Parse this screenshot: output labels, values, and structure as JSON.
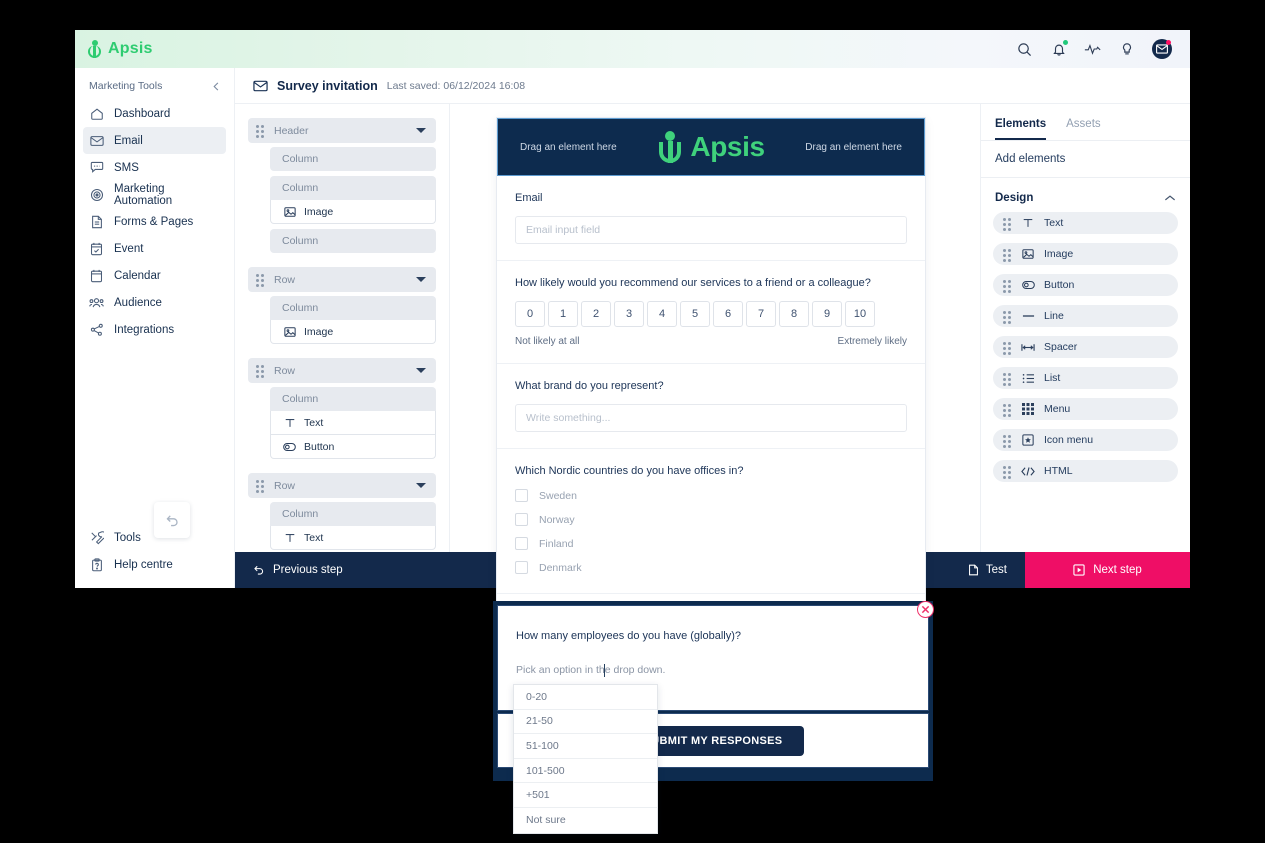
{
  "app": {
    "brand": "Apsis",
    "top_icons": [
      "search-icon",
      "bell-icon",
      "activity-icon",
      "lightbulb-icon",
      "inbox-avatar-icon"
    ]
  },
  "sidebar": {
    "section_label": "Marketing Tools",
    "collapse_icon": "chevron-left-icon",
    "items": [
      {
        "label": "Dashboard",
        "icon": "home-icon",
        "active": false
      },
      {
        "label": "Email",
        "icon": "envelope-icon",
        "active": true
      },
      {
        "label": "SMS",
        "icon": "chat-icon",
        "active": false
      },
      {
        "label": "Marketing Automation",
        "icon": "target-icon",
        "active": false
      },
      {
        "label": "Forms & Pages",
        "icon": "document-icon",
        "active": false
      },
      {
        "label": "Event",
        "icon": "calendar-check-icon",
        "active": false
      },
      {
        "label": "Calendar",
        "icon": "calendar-icon",
        "active": false
      },
      {
        "label": "Audience",
        "icon": "people-icon",
        "active": false
      },
      {
        "label": "Integrations",
        "icon": "share-nodes-icon",
        "active": false
      }
    ],
    "bottom_items": [
      {
        "label": "Tools",
        "icon": "tools-icon"
      },
      {
        "label": "Help centre",
        "icon": "help-clipboard-icon"
      }
    ]
  },
  "header": {
    "icon": "envelope-icon",
    "title": "Survey invitation",
    "last_saved": "Last saved: 06/12/2024 16:08"
  },
  "tree": {
    "blocks": [
      {
        "label": "Header",
        "children": [
          {
            "type": "column",
            "label": "Column",
            "leaves": []
          },
          {
            "type": "column",
            "label": "Column",
            "leaves": [
              {
                "label": "Image",
                "icon": "image-icon"
              }
            ]
          },
          {
            "type": "column",
            "label": "Column",
            "leaves": []
          }
        ]
      },
      {
        "label": "Row",
        "children": [
          {
            "type": "column",
            "label": "Column",
            "leaves": [
              {
                "label": "Image",
                "icon": "image-icon"
              }
            ]
          }
        ]
      },
      {
        "label": "Row",
        "children": [
          {
            "type": "column",
            "label": "Column",
            "leaves": [
              {
                "label": "Text",
                "icon": "text-icon"
              },
              {
                "label": "Button",
                "icon": "button-icon"
              }
            ]
          }
        ]
      },
      {
        "label": "Row",
        "children": [
          {
            "type": "column",
            "label": "Column",
            "leaves": [
              {
                "label": "Text",
                "icon": "text-icon"
              }
            ]
          }
        ]
      }
    ]
  },
  "canvas": {
    "undo_icon": "undo-icon"
  },
  "elements_panel": {
    "tabs": [
      {
        "label": "Elements",
        "active": true
      },
      {
        "label": "Assets",
        "active": false
      }
    ],
    "add_elements_label": "Add elements",
    "design_section": {
      "title": "Design",
      "chevron": "chevron-up-icon",
      "items": [
        {
          "label": "Text",
          "icon": "text-icon"
        },
        {
          "label": "Image",
          "icon": "image-icon"
        },
        {
          "label": "Button",
          "icon": "button-icon"
        },
        {
          "label": "Line",
          "icon": "line-icon"
        },
        {
          "label": "Spacer",
          "icon": "spacer-icon"
        },
        {
          "label": "List",
          "icon": "list-icon"
        },
        {
          "label": "Menu",
          "icon": "menu-grid-icon"
        },
        {
          "label": "Icon menu",
          "icon": "icon-menu-icon"
        },
        {
          "label": "HTML",
          "icon": "code-icon"
        }
      ]
    }
  },
  "bottom_bar": {
    "previous_label": "Previous step",
    "previous_icon": "undo-icon",
    "test_label": "Test",
    "test_icon": "test-page-icon",
    "next_label": "Next step",
    "next_icon": "play-square-icon",
    "next_color": "#ef0e66"
  },
  "email_preview": {
    "header": {
      "drag_left": "Drag an element here",
      "drag_right": "Drag an element here",
      "logo_text": "Apsis",
      "bg_color": "#0d2b4e",
      "logo_color": "#3fd17c"
    },
    "email_field": {
      "label": "Email",
      "placeholder": "Email input field",
      "value": ""
    },
    "nps": {
      "question": "How likely would you recommend our services to a friend or a colleague?",
      "options": [
        "0",
        "1",
        "2",
        "3",
        "4",
        "5",
        "6",
        "7",
        "8",
        "9",
        "10"
      ],
      "low_label": "Not likely at all",
      "high_label": "Extremely likely"
    },
    "brand_field": {
      "question": "What brand do you represent?",
      "placeholder": "Write something...",
      "value": ""
    },
    "countries": {
      "question": "Which Nordic countries do you have offices in?",
      "options": [
        "Sweden",
        "Norway",
        "Finland",
        "Denmark"
      ]
    },
    "submit_label": "SUBMIT MY RESPONSES"
  },
  "dropdown_overlay": {
    "question": "How many employees do you have (globally)?",
    "hint": "Pick an option in the drop down.",
    "close_icon": "close-circle-icon",
    "submit_label": "SUBMIT MY RESPONSES",
    "options": [
      "0-20",
      "21-50",
      "51-100",
      "101-500",
      "+501",
      "Not sure"
    ]
  }
}
